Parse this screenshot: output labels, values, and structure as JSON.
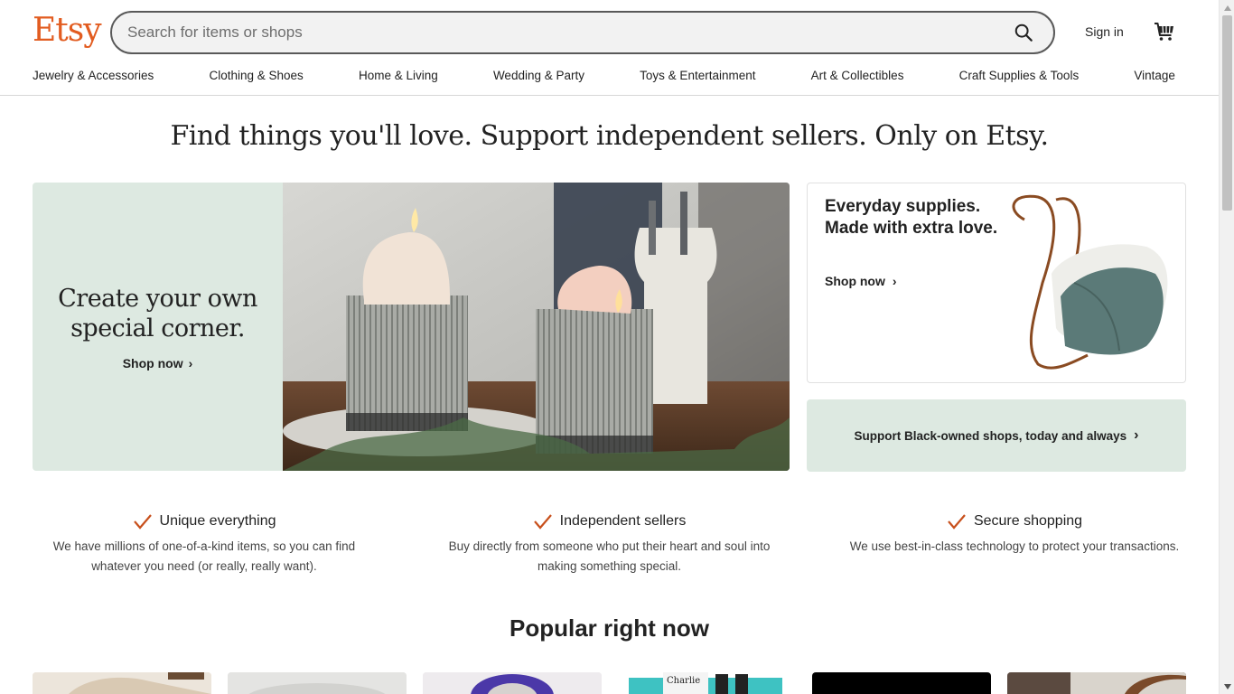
{
  "header": {
    "logo": "Etsy",
    "search_placeholder": "Search for items or shops",
    "sign_in": "Sign in"
  },
  "nav": [
    "Jewelry & Accessories",
    "Clothing & Shoes",
    "Home & Living",
    "Wedding & Party",
    "Toys & Entertainment",
    "Art & Collectibles",
    "Craft Supplies & Tools",
    "Vintage"
  ],
  "hero": {
    "tagline": "Find things you'll love. Support independent sellers. Only on Etsy.",
    "main_headline": "Create your own special corner.",
    "main_cta": "Shop now",
    "supplies_title": "Everyday supplies. Made with extra love.",
    "supplies_cta": "Shop now",
    "support_cta": "Support Black-owned shops, today and always"
  },
  "value_props": [
    {
      "title": "Unique everything",
      "body": "We have millions of one-of-a-kind items, so you can find whatever you need (or really, really want)."
    },
    {
      "title": "Independent sellers",
      "body": "Buy directly from someone who put their heart and soul into making something special."
    },
    {
      "title": "Secure shopping",
      "body": "We use best-in-class technology to protect your transactions."
    }
  ],
  "popular": {
    "title": "Popular right now",
    "thumb_label": "Charlie"
  },
  "colors": {
    "brand": "#e25c20",
    "mint": "#dde9e1",
    "check": "#c8501c"
  }
}
